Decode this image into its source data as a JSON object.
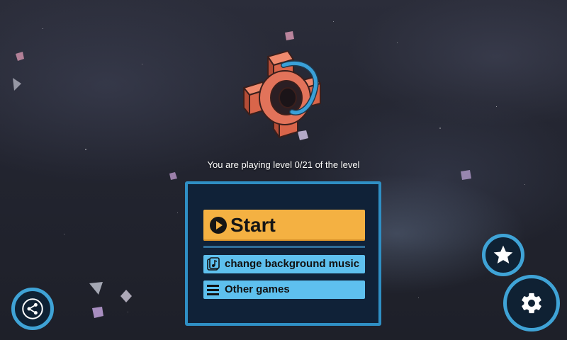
{
  "status": {
    "level_text": "You are playing level 0/21 of the level"
  },
  "menu": {
    "start_label": "Start",
    "music_label": "change background music",
    "other_games_label": "Other games"
  },
  "icons": {
    "logo": "cube-ring-logo-icon",
    "start": "play-circle-icon",
    "music": "music-note-icon",
    "other_games": "hamburger-menu-icon",
    "favorite": "star-icon",
    "settings": "gear-icon",
    "share": "share-icon"
  },
  "colors": {
    "start_button": "#f4b142",
    "secondary_button": "#5ec0ee",
    "panel_background": "#102238",
    "panel_border": "#2f8fc4",
    "round_button_border": "#3fa3d6"
  }
}
